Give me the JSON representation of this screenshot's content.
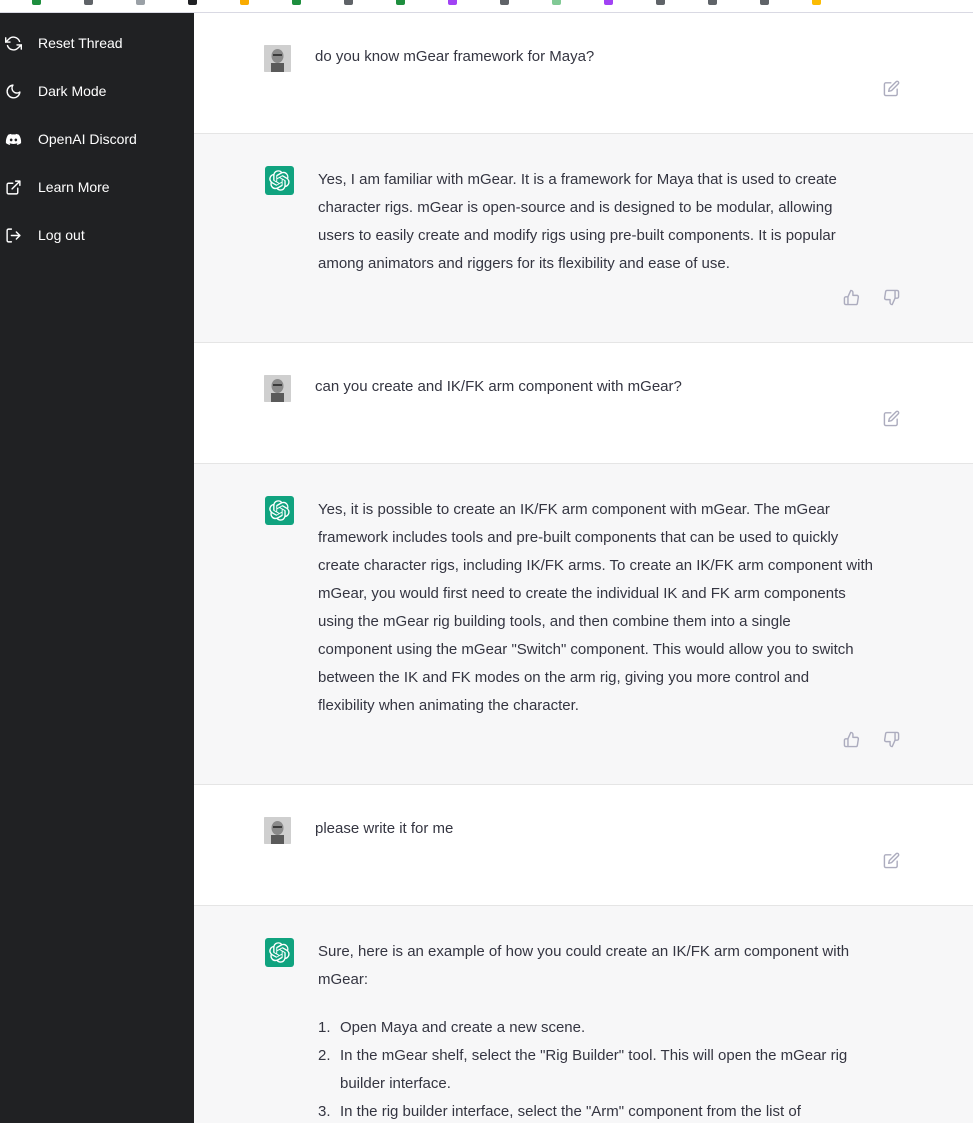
{
  "browser": {
    "bookmark_colors": [
      "#1e8e3e",
      "#5f6368",
      "#9aa0a6",
      "#202124",
      "#f9ab00",
      "#1e8e3e",
      "#5f6368",
      "#1e8e3e",
      "#a142f4",
      "#5f6368",
      "#81c995",
      "#a142f4",
      "#5f6368",
      "#5f6368",
      "#5f6368",
      "#fbbc04"
    ]
  },
  "sidebar": {
    "items": [
      {
        "label": "Reset Thread",
        "icon": "refresh-icon"
      },
      {
        "label": "Dark Mode",
        "icon": "moon-icon"
      },
      {
        "label": "OpenAI Discord",
        "icon": "discord-icon"
      },
      {
        "label": "Learn More",
        "icon": "external-link-icon"
      },
      {
        "label": "Log out",
        "icon": "logout-icon"
      }
    ]
  },
  "conversation": {
    "messages": [
      {
        "role": "user",
        "text": "do you know mGear framework for Maya?"
      },
      {
        "role": "assistant",
        "lines": [
          "Yes, I am familiar with mGear. It is a framework for Maya that is used to create",
          "character rigs. mGear is open-source and is designed to be modular, allowing",
          "users to easily create and modify rigs using pre-built components. It is popular",
          "among animators and riggers for its flexibility and ease of use."
        ]
      },
      {
        "role": "user",
        "text": "can you create and IK/FK arm component with mGear?"
      },
      {
        "role": "assistant",
        "lines": [
          "Yes, it is possible to create an IK/FK arm component with mGear. The mGear",
          "framework includes tools and pre-built components that can be used to quickly",
          "create character rigs, including IK/FK arms. To create an IK/FK arm component with",
          "mGear, you would first need to create the individual IK and FK arm components",
          "using the mGear rig building tools, and then combine them into a single",
          "component using the mGear \"Switch\" component. This would allow you to switch",
          "between the IK and FK modes on the arm rig, giving you more control and",
          "flexibility when animating the character."
        ]
      },
      {
        "role": "user",
        "text": "please write it for me"
      },
      {
        "role": "assistant",
        "lines": [
          "Sure, here is an example of how you could create an IK/FK arm component with",
          "mGear:"
        ],
        "steps": [
          {
            "num": "1.",
            "lines": [
              "Open Maya and create a new scene."
            ]
          },
          {
            "num": "2.",
            "lines": [
              "In the mGear shelf, select the \"Rig Builder\" tool. This will open the mGear rig",
              "builder interface."
            ]
          },
          {
            "num": "3.",
            "lines": [
              "In the rig builder interface, select the \"Arm\" component from the list of"
            ]
          }
        ]
      }
    ]
  },
  "colors": {
    "sidebar_bg": "#202123",
    "assistant_bg": "#f7f7f8",
    "brand_green": "#10a37f",
    "text": "#343541",
    "icon_gray": "#acacbe"
  }
}
